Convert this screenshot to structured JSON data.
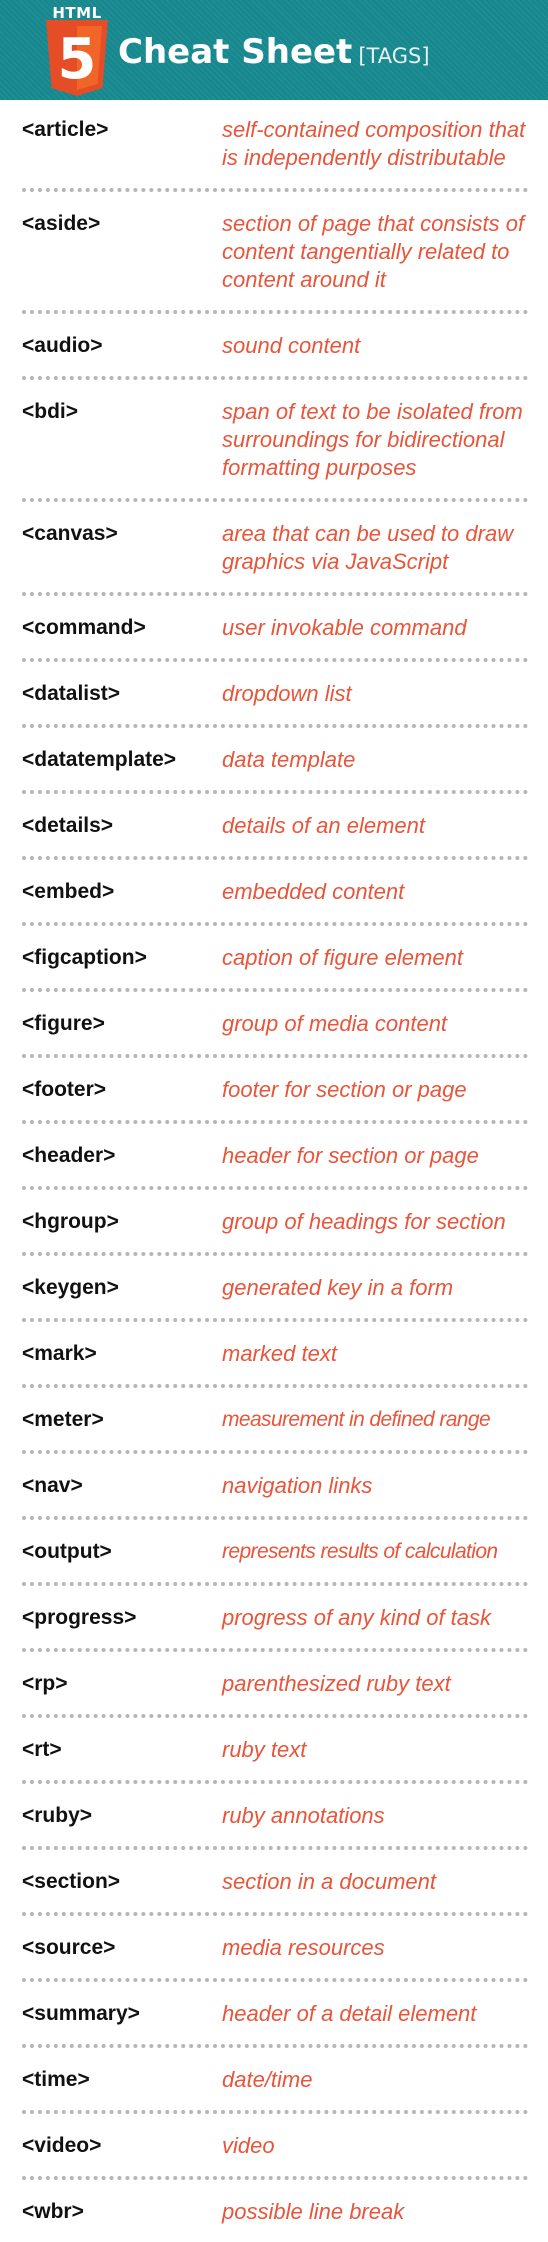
{
  "header": {
    "logo_text": "HTML",
    "logo_number": "5",
    "title": "Cheat Sheet",
    "subtitle": "[TAGS]"
  },
  "tags": [
    {
      "name": "<article>",
      "desc": "self-contained composition that is independently distributable"
    },
    {
      "name": "<aside>",
      "desc": "section of page that consists of content tangentially related to content around it"
    },
    {
      "name": "<audio>",
      "desc": "sound content"
    },
    {
      "name": "<bdi>",
      "desc": "span of text to be isolated from surroundings for bidirectional formatting purposes"
    },
    {
      "name": "<canvas>",
      "desc": "area that can be used to draw graphics via JavaScript"
    },
    {
      "name": "<command>",
      "desc": "user invokable command"
    },
    {
      "name": "<datalist>",
      "desc": "dropdown list"
    },
    {
      "name": "<datatemplate>",
      "desc": "data template"
    },
    {
      "name": "<details>",
      "desc": "details of an element"
    },
    {
      "name": "<embed>",
      "desc": "embedded content"
    },
    {
      "name": "<figcaption>",
      "desc": "caption of figure element"
    },
    {
      "name": "<figure>",
      "desc": "group of media content"
    },
    {
      "name": "<footer>",
      "desc": "footer for section or page"
    },
    {
      "name": "<header>",
      "desc": "header for section or page"
    },
    {
      "name": "<hgroup>",
      "desc": "group of headings for section"
    },
    {
      "name": "<keygen>",
      "desc": "generated key in a form"
    },
    {
      "name": "<mark>",
      "desc": "marked text"
    },
    {
      "name": "<meter>",
      "desc": "measurement in defined range"
    },
    {
      "name": "<nav>",
      "desc": "navigation links"
    },
    {
      "name": "<output>",
      "desc": "represents results of calculation"
    },
    {
      "name": "<progress>",
      "desc": "progress of any kind of task"
    },
    {
      "name": "<rp>",
      "desc": "parenthesized ruby text"
    },
    {
      "name": "<rt>",
      "desc": "ruby text"
    },
    {
      "name": "<ruby>",
      "desc": "ruby annotations"
    },
    {
      "name": "<section>",
      "desc": "section in a document"
    },
    {
      "name": "<source>",
      "desc": "media resources"
    },
    {
      "name": "<summary>",
      "desc": "header of a detail element"
    },
    {
      "name": "<time>",
      "desc": "date/time"
    },
    {
      "name": "<video>",
      "desc": "video"
    },
    {
      "name": "<wbr>",
      "desc": "possible line break"
    }
  ],
  "colors": {
    "header_bg": "#17888e",
    "logo_orange": "#e44d26",
    "logo_orange_light": "#f16529",
    "desc_text": "#e8553a",
    "tag_text": "#111111",
    "divider": "#b6b6b6"
  }
}
